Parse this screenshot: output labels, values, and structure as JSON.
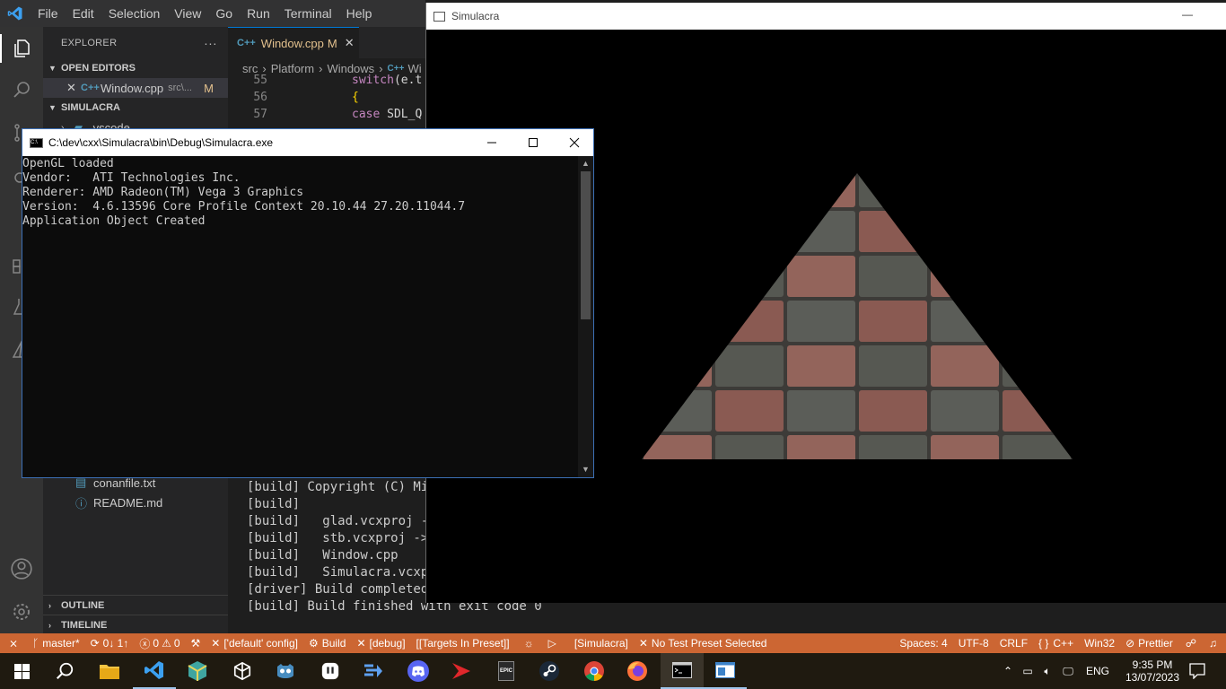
{
  "menu": {
    "items": [
      "File",
      "Edit",
      "Selection",
      "View",
      "Go",
      "Run",
      "Terminal",
      "Help"
    ]
  },
  "sidebar": {
    "header": "EXPLORER",
    "more": "···",
    "open_editors": "OPEN EDITORS",
    "open_file": {
      "name": "Window.cpp",
      "path": "src\\...",
      "badge": "M"
    },
    "project": "SIMULACRA",
    "folder_partial": ".vscode",
    "files": [
      "conanfile.txt",
      "README.md"
    ],
    "outline": "OUTLINE",
    "timeline": "TIMELINE"
  },
  "editor": {
    "tab": {
      "label": "Window.cpp",
      "badge": "M"
    },
    "breadcrumb": [
      "src",
      "Platform",
      "Windows",
      "Wi"
    ],
    "lines": [
      {
        "num": "55",
        "kw": "switch",
        "rest": "(e.t"
      },
      {
        "num": "56",
        "kw": "",
        "rest": "{"
      },
      {
        "num": "57",
        "kw": "case",
        "rest": " SDL_Q"
      }
    ]
  },
  "terminal": {
    "lines": [
      "[build] Copyright (C) Mi",
      "[build]",
      "[build]   glad.vcxproj -",
      "[build]   stb.vcxproj ->",
      "[build]   Window.cpp",
      "[build]   Simulacra.vcxp",
      "[driver] Build completed",
      "[build] Build finished with exit code 0"
    ]
  },
  "simulacra_window": {
    "title": "Simulacra",
    "minimize": "—"
  },
  "console": {
    "title": "C:\\dev\\cxx\\Simulacra\\bin\\Debug\\Simulacra.exe",
    "icon_text": "C:\\",
    "lines": [
      "OpenGL loaded",
      "Vendor:   ATI Technologies Inc.",
      "Renderer: AMD Radeon(TM) Vega 3 Graphics",
      "Version:  4.6.13596 Core Profile Context 20.10.44 27.20.11044.7",
      "Application Object Created"
    ]
  },
  "statusbar": {
    "branch": "master*",
    "sync": "0↓ 1↑",
    "errors": "0",
    "warnings": "0",
    "config": "['default' config]",
    "build": "Build",
    "debug": "[debug]",
    "targets": "[[Targets In Preset]]",
    "target": "[Simulacra]",
    "test_preset": "No Test Preset Selected",
    "spaces": "Spaces: 4",
    "encoding": "UTF-8",
    "eol": "CRLF",
    "language": "C++",
    "platform": "Win32",
    "formatter": "Prettier"
  },
  "taskbar": {
    "lang": "ENG",
    "time": "9:35 PM",
    "date": "13/07/2023",
    "epic_label": "EPIC"
  },
  "colors": {
    "statusbar": "#cc6633",
    "accent": "#0078d4",
    "taskbar": "#1f1a10"
  }
}
